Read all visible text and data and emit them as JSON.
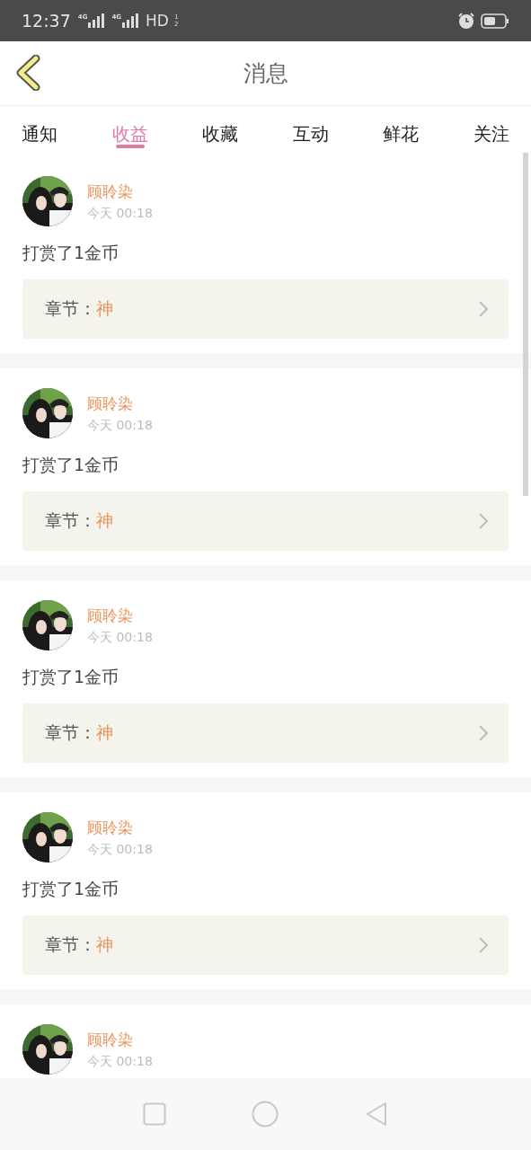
{
  "status_bar": {
    "time": "12:37",
    "network_1": "4G",
    "network_2": "4G",
    "hd": "HD",
    "sim_1": "1",
    "sim_2": "2"
  },
  "header": {
    "title": "消息"
  },
  "tabs": [
    {
      "label": "通知",
      "selected": false
    },
    {
      "label": "收益",
      "selected": true
    },
    {
      "label": "收藏",
      "selected": false
    },
    {
      "label": "互动",
      "selected": false
    },
    {
      "label": "鲜花",
      "selected": false
    },
    {
      "label": "关注",
      "selected": false
    }
  ],
  "messages": [
    {
      "user": "顾聆染",
      "time": "今天 00:18",
      "text": "打赏了1金币",
      "chapter_label": "章节：",
      "chapter": "神"
    },
    {
      "user": "顾聆染",
      "time": "今天 00:18",
      "text": "打赏了1金币",
      "chapter_label": "章节：",
      "chapter": "神"
    },
    {
      "user": "顾聆染",
      "time": "今天 00:18",
      "text": "打赏了1金币",
      "chapter_label": "章节：",
      "chapter": "神"
    },
    {
      "user": "顾聆染",
      "time": "今天 00:18",
      "text": "打赏了1金币",
      "chapter_label": "章节：",
      "chapter": "神"
    },
    {
      "user": "顾聆染",
      "time": "今天 00:18"
    }
  ]
}
